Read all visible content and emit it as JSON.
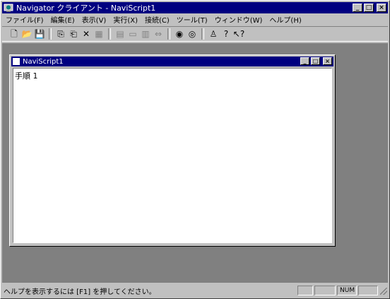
{
  "window": {
    "title": "Navigator クライアント - NaviScript1",
    "minimize_label": "_",
    "maximize_label": "□",
    "close_label": "×"
  },
  "menubar": {
    "items": [
      {
        "label": "ファイル(F)"
      },
      {
        "label": "編集(E)"
      },
      {
        "label": "表示(V)"
      },
      {
        "label": "実行(X)"
      },
      {
        "label": "接続(C)"
      },
      {
        "label": "ツール(T)"
      },
      {
        "label": "ウィンドウ(W)"
      },
      {
        "label": "ヘルプ(H)"
      }
    ]
  },
  "toolbar": {
    "buttons": [
      {
        "name": "new-file-icon",
        "glyph": "🗋",
        "enabled": true
      },
      {
        "name": "open-folder-icon",
        "glyph": "📂",
        "enabled": true
      },
      {
        "name": "save-icon",
        "glyph": "💾",
        "enabled": true
      },
      {
        "name": "separator"
      },
      {
        "name": "insert-step-icon",
        "glyph": "⎘",
        "enabled": true
      },
      {
        "name": "add-step-icon",
        "glyph": "⎗",
        "enabled": true
      },
      {
        "name": "delete-icon",
        "glyph": "✕",
        "enabled": true
      },
      {
        "name": "properties-icon",
        "glyph": "▦",
        "enabled": false
      },
      {
        "name": "separator"
      },
      {
        "name": "step-edit-icon",
        "glyph": "▤",
        "enabled": false
      },
      {
        "name": "step-list-icon",
        "glyph": "▭",
        "enabled": false
      },
      {
        "name": "step-move-icon",
        "glyph": "▥",
        "enabled": false
      },
      {
        "name": "step-split-icon",
        "glyph": "⇔",
        "enabled": false
      },
      {
        "name": "separator"
      },
      {
        "name": "connect-icon",
        "glyph": "◉",
        "enabled": true
      },
      {
        "name": "disconnect-icon",
        "glyph": "◎",
        "enabled": true
      },
      {
        "name": "separator"
      },
      {
        "name": "user-icon",
        "glyph": "♙",
        "enabled": true
      },
      {
        "name": "help-icon",
        "glyph": "?",
        "enabled": true
      },
      {
        "name": "context-help-icon",
        "glyph": "↖?",
        "enabled": true
      }
    ]
  },
  "child_window": {
    "title": "NaviScript1",
    "first_line": "手順 1"
  },
  "statusbar": {
    "message": "ヘルプを表示するには [F1] を押してください。",
    "panels": [
      "",
      "",
      "NUM",
      ""
    ]
  }
}
